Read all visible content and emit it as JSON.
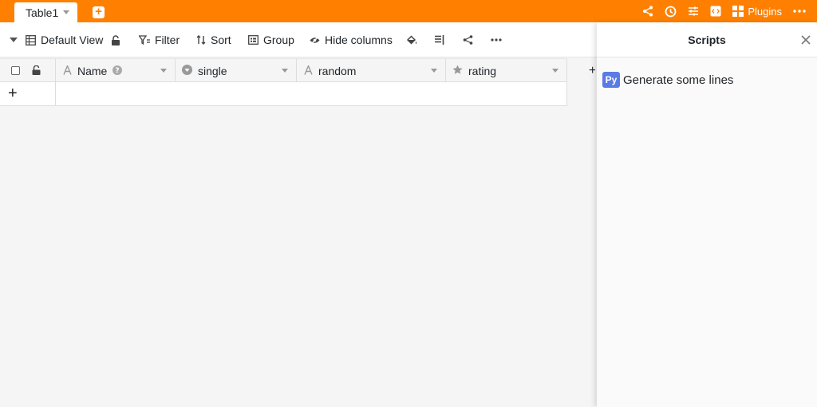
{
  "header": {
    "active_tab": "Table1",
    "plugins_label": "Plugins",
    "icons": [
      "share-icon",
      "history-icon",
      "settings-sliders-icon",
      "code-icon",
      "plugins-icon",
      "more-horizontal-icon"
    ],
    "accent_color": "#ff8000"
  },
  "toolbar": {
    "view_label": "Default View",
    "filter_label": "Filter",
    "sort_label": "Sort",
    "group_label": "Group",
    "hide_columns_label": "Hide columns"
  },
  "grid": {
    "columns": [
      {
        "name": "Name",
        "icon": "text-icon"
      },
      {
        "name": "single",
        "icon": "single-select-icon"
      },
      {
        "name": "random",
        "icon": "text-icon"
      },
      {
        "name": "rating",
        "icon": "star-icon"
      }
    ],
    "add_row_label": "+",
    "next_col_glyph": "+"
  },
  "scripts_panel": {
    "title": "Scripts",
    "scripts": [
      {
        "badge": "Py",
        "name": "Generate some lines"
      }
    ],
    "badge_color": "#5a7ae6"
  }
}
